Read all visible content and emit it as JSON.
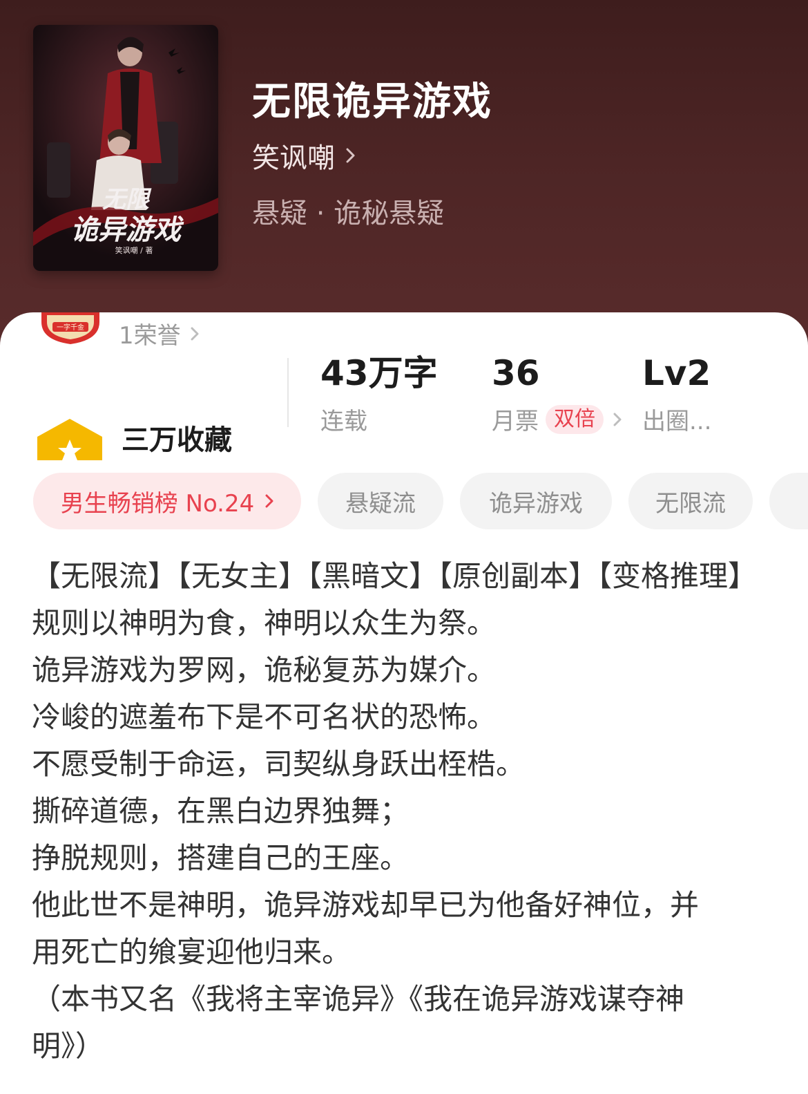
{
  "book": {
    "title": "无限诡异游戏",
    "author": "笑讽嘲",
    "genre": "悬疑 · 诡秘悬疑",
    "cover_title": "无限诡异游戏",
    "cover_author": "笑讽嘲 / 著"
  },
  "honor": {
    "badge_text": "一字千金",
    "text": "1荣誉"
  },
  "favorites": {
    "label": "三万收藏"
  },
  "stats": {
    "words_value": "43万字",
    "words_label": "连载",
    "tickets_value": "36",
    "tickets_label": "月票",
    "tickets_badge": "双倍",
    "level_value": "Lv2",
    "level_label": "出圈..."
  },
  "tags": [
    {
      "label": "男生畅销榜 No.24"
    },
    {
      "label": "悬疑流"
    },
    {
      "label": "诡异游戏"
    },
    {
      "label": "无限流"
    }
  ],
  "description": [
    "【无限流】【无女主】【黑暗文】【原创副本】【变格推理】",
    "规则以神明为食，神明以众生为祭。",
    "诡异游戏为罗网，诡秘复苏为媒介。",
    "冷峻的遮羞布下是不可名状的恐怖。",
    "不愿受制于命运，司契纵身跃出桎梏。",
    "撕碎道德，在黑白边界独舞；",
    "挣脱规则，搭建自己的王座。",
    "他此世不是神明，诡异游戏却早已为他备好神位，并",
    "用死亡的飨宴迎他归来。",
    "（本书又名《我将主宰诡异》《我在诡异游戏谋夺神",
    "明》）"
  ],
  "colors": {
    "header_bg": "#4d2525",
    "accent_red": "#e8424f",
    "tag_bg": "#f3f3f3",
    "fav_yellow": "#f5b800"
  }
}
